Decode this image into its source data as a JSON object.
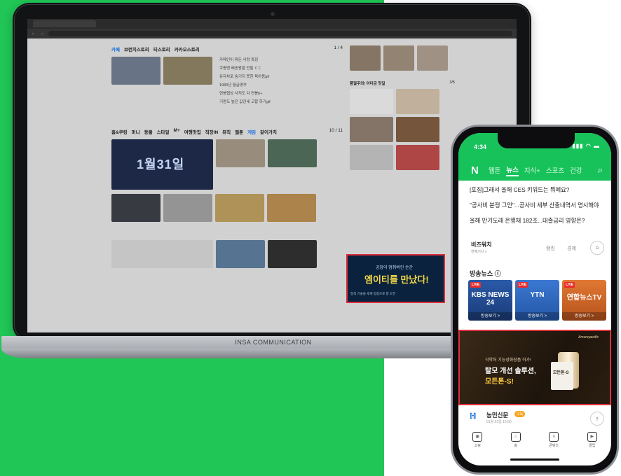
{
  "laptop": {
    "base_label": "INSA COMMUNICATION",
    "web": {
      "row1_title": [
        "카페",
        "브런치스토리",
        "티스토리",
        "카카오스토리"
      ],
      "row1_counter": "1 / 4",
      "row1_lines": [
        "카페인이 뭐든 사랑 특징",
        "쿠팡맨 배송왕을 만들 ㄷㄷ",
        "유자차로 숨기지 못한 육아용gif",
        "1980년 월급명부",
        "연봉협상 사직도 다 연봉b+",
        "기판도 높은 값관세 고합 하기gif"
      ],
      "row2_title": [
        "홈&쿠킹",
        "머니",
        "동물",
        "스타일",
        "M+",
        "여행맛집",
        "직장IN",
        "뮤직",
        "웹툰",
        "게임",
        "같이가치"
      ],
      "row2_counter": "10 / 11",
      "big_thumb_text": "1월31일",
      "side_title": "품절주의! 아더금 찻딜",
      "side_counter": "3/5",
      "ad_line1": "공장이 멈춰버린 순간",
      "ad_line2": "엠이티를 만났다!",
      "ad_line3": "정직 기술을 세계 정점으로 향 도전"
    }
  },
  "phone": {
    "time": "4:34",
    "status_icons": "▮▮▮ ◠ ▬",
    "nav_logo": "N",
    "nav_tabs": [
      "웹툰",
      "뉴스",
      "지식+",
      "스포츠",
      "건강"
    ],
    "nav_active": "뉴스",
    "headlines": [
      "[포집]그래서 올해 CES 키워드는 뭐예요?",
      "\"공사비 분쟁 그만\"...공사비 세부 산출내역서 명시해야",
      "올해 만기도래 은행채 182조...대출금리 영향은?"
    ],
    "biz": {
      "name": "비즈워치",
      "sub": "전체기사 >",
      "opt1": "랭킹",
      "opt2": "경제",
      "icon": "⌂"
    },
    "section_title": "방송뉴스 ⓘ",
    "broadcasts": [
      {
        "live": "LIVE",
        "logo": "KBS NEWS 24",
        "watch": "방송보기 >"
      },
      {
        "live": "LIVE",
        "logo": "YTN",
        "watch": "방송보기 >"
      },
      {
        "live": "LIVE",
        "logo": "연합뉴스TV",
        "watch": "방송보기 >"
      }
    ],
    "ad": {
      "brand": "Amorepacific",
      "t1": "식약처 기능성화장품 허가!",
      "t2": "탈모 개선 솔루션,",
      "t3": "모든톤-S!",
      "box_label": "모든톤-S"
    },
    "publisher": {
      "logo": "ℍ",
      "name": "농민신문",
      "badge": "구독",
      "date": "01월 23일 16:00",
      "top": "↑"
    },
    "tabbar": [
      {
        "icon": "▣",
        "label": "쇼핑"
      },
      {
        "icon": "⌂",
        "label": "홈"
      },
      {
        "icon": "≡",
        "label": "콘텐츠"
      },
      {
        "icon": "▶",
        "label": "클립"
      }
    ]
  }
}
